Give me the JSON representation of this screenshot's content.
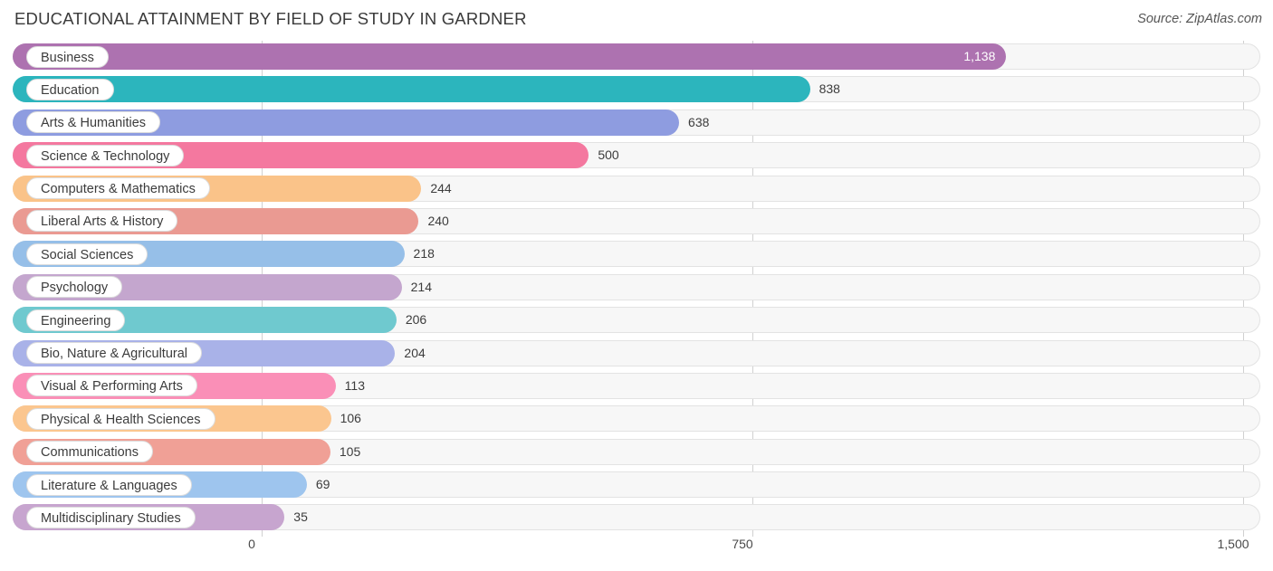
{
  "header": {
    "title": "EDUCATIONAL ATTAINMENT BY FIELD OF STUDY IN GARDNER",
    "source": "Source: ZipAtlas.com"
  },
  "chart_data": {
    "type": "bar",
    "orientation": "horizontal",
    "title": "EDUCATIONAL ATTAINMENT BY FIELD OF STUDY IN GARDNER",
    "xlabel": "",
    "ylabel": "",
    "xlim": [
      0,
      1500
    ],
    "xticks": [
      "0",
      "750",
      "1,500"
    ],
    "xtick_values": [
      0,
      750,
      1500
    ],
    "grid": true,
    "legend": false,
    "categories": [
      "Business",
      "Education",
      "Arts & Humanities",
      "Science & Technology",
      "Computers & Mathematics",
      "Liberal Arts & History",
      "Social Sciences",
      "Psychology",
      "Engineering",
      "Bio, Nature & Agricultural",
      "Visual & Performing Arts",
      "Physical & Health Sciences",
      "Communications",
      "Literature & Languages",
      "Multidisciplinary Studies"
    ],
    "values": [
      1138,
      838,
      638,
      500,
      244,
      240,
      218,
      214,
      206,
      204,
      113,
      106,
      105,
      69,
      35
    ],
    "value_labels": [
      "1,138",
      "838",
      "638",
      "500",
      "244",
      "240",
      "218",
      "214",
      "206",
      "204",
      "113",
      "106",
      "105",
      "69",
      "35"
    ],
    "colors": [
      "#ad72b0",
      "#2cb5bd",
      "#8e9ce0",
      "#f4789f",
      "#fac389",
      "#ea9a92",
      "#96bfe8",
      "#c4a6ce",
      "#6fc9cf",
      "#a9b2e8",
      "#fa8fb7",
      "#fbc68f",
      "#f0a096",
      "#9ec5ee",
      "#c7a5cf"
    ]
  },
  "axis": {
    "ticks": [
      {
        "label": "0",
        "value": 0
      },
      {
        "label": "750",
        "value": 750
      },
      {
        "label": "1,500",
        "value": 1500
      }
    ]
  }
}
